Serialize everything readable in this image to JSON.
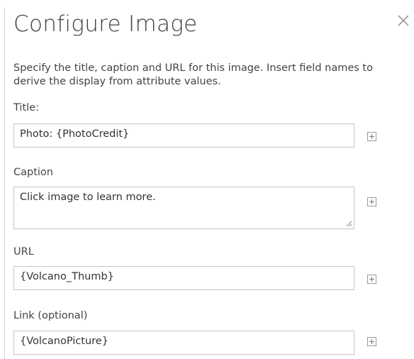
{
  "dialog": {
    "title": "Configure Image",
    "close_icon": "close-icon",
    "description": "Specify the title, caption and URL for this image. Insert field names to derive the display from attribute values."
  },
  "fields": {
    "title": {
      "label": "Title:",
      "value": "Photo: {PhotoCredit}",
      "insert_icon": "plus-box-icon"
    },
    "caption": {
      "label": "Caption",
      "value": "Click image to learn more.",
      "insert_icon": "plus-box-icon"
    },
    "url": {
      "label": "URL",
      "value": "{Volcano_Thumb}",
      "insert_icon": "plus-box-icon"
    },
    "link": {
      "label": "Link (optional)",
      "value": "{VolcanoPicture}",
      "insert_icon": "plus-box-icon"
    }
  },
  "colors": {
    "border": "#c6c6c6",
    "text": "#444444",
    "icon": "#999999"
  }
}
